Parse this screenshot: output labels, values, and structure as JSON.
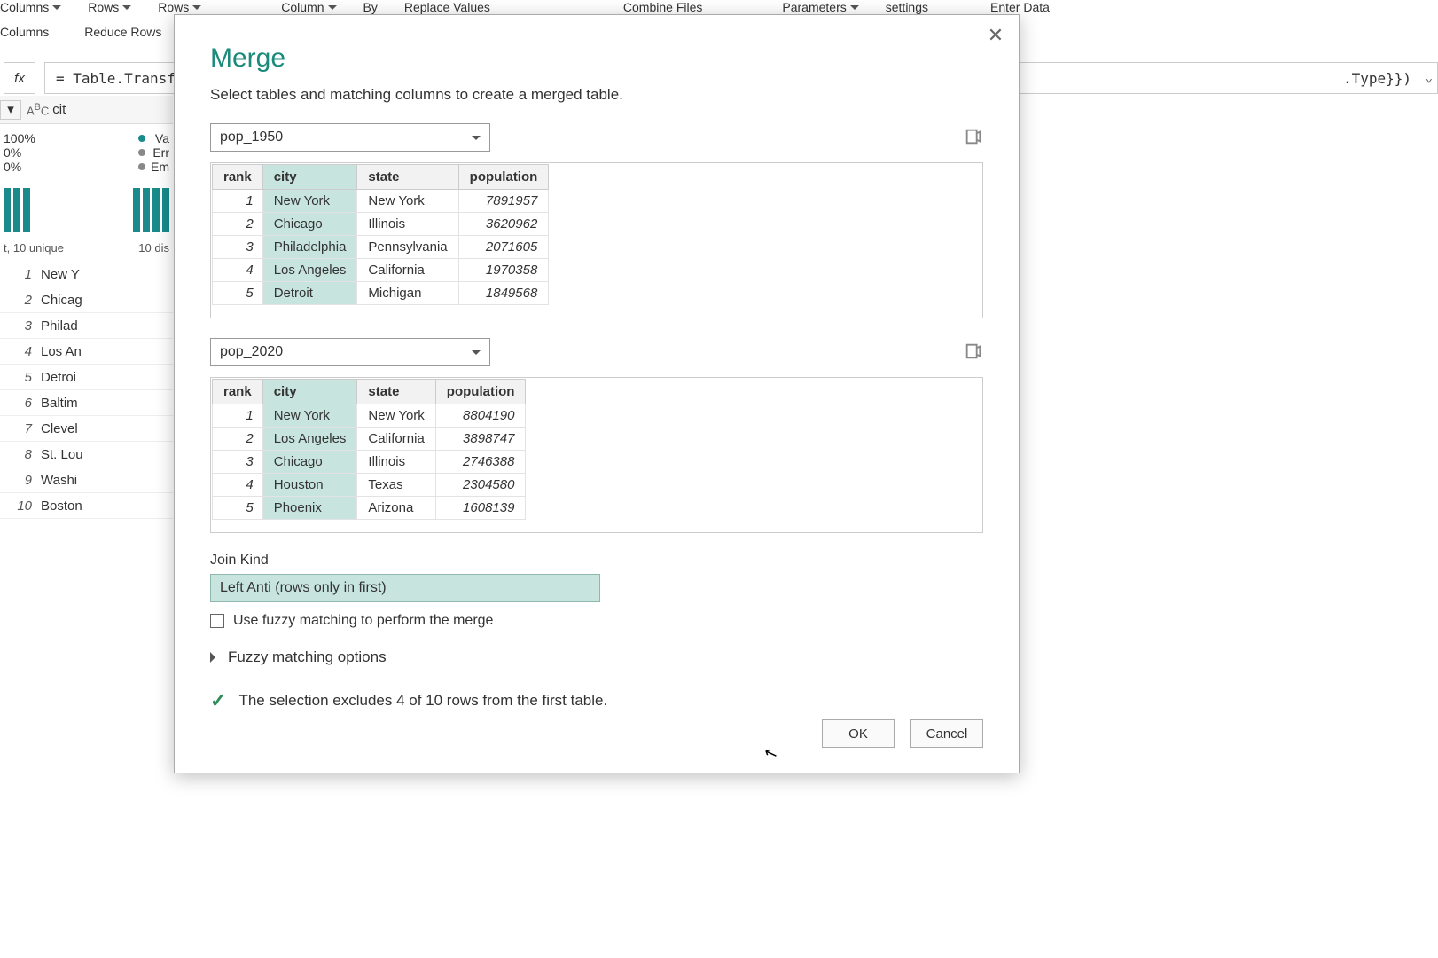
{
  "ribbon": {
    "items": [
      "Columns",
      "Rows",
      "Rows",
      "Column",
      "By",
      "Replace Values",
      "Combine Files",
      "Parameters",
      "settings",
      "Enter Data"
    ],
    "sub": [
      "Columns",
      "Reduce Rows"
    ]
  },
  "formula": {
    "fx": "fx",
    "text": "= Table.Transfor",
    "tail": ".Type}})"
  },
  "bg": {
    "col_header": "cit",
    "stats": [
      {
        "val": "100%",
        "label": "Va",
        "color": "#1a8a8a"
      },
      {
        "val": "0%",
        "label": "Err",
        "color": "#888"
      },
      {
        "val": "0%",
        "label": "Em",
        "color": "#888"
      }
    ],
    "dist_left": "t, 10 unique",
    "dist_right": "10 dis",
    "rows": [
      "New Y",
      "Chicag",
      "Philad",
      "Los An",
      "Detroi",
      "Baltim",
      "Clevel",
      "St. Lou",
      "Washi",
      "Boston"
    ]
  },
  "dialog": {
    "title": "Merge",
    "description": "Select tables and matching columns to create a merged table.",
    "table1": {
      "name": "pop_1950",
      "columns": [
        "rank",
        "city",
        "state",
        "population"
      ],
      "selected_col": "city",
      "rows": [
        {
          "rank": 1,
          "city": "New York",
          "state": "New York",
          "population": 7891957
        },
        {
          "rank": 2,
          "city": "Chicago",
          "state": "Illinois",
          "population": 3620962
        },
        {
          "rank": 3,
          "city": "Philadelphia",
          "state": "Pennsylvania",
          "population": 2071605
        },
        {
          "rank": 4,
          "city": "Los Angeles",
          "state": "California",
          "population": 1970358
        },
        {
          "rank": 5,
          "city": "Detroit",
          "state": "Michigan",
          "population": 1849568
        }
      ]
    },
    "table2": {
      "name": "pop_2020",
      "columns": [
        "rank",
        "city",
        "state",
        "population"
      ],
      "selected_col": "city",
      "rows": [
        {
          "rank": 1,
          "city": "New York",
          "state": "New York",
          "population": 8804190
        },
        {
          "rank": 2,
          "city": "Los Angeles",
          "state": "California",
          "population": 3898747
        },
        {
          "rank": 3,
          "city": "Chicago",
          "state": "Illinois",
          "population": 2746388
        },
        {
          "rank": 4,
          "city": "Houston",
          "state": "Texas",
          "population": 2304580
        },
        {
          "rank": 5,
          "city": "Phoenix",
          "state": "Arizona",
          "population": 1608139
        }
      ]
    },
    "join_kind_label": "Join Kind",
    "join_kind_value": "Left Anti (rows only in first)",
    "fuzzy_checkbox": "Use fuzzy matching to perform the merge",
    "fuzzy_expander": "Fuzzy matching options",
    "status": "The selection excludes 4 of 10 rows from the first table.",
    "ok": "OK",
    "cancel": "Cancel"
  }
}
